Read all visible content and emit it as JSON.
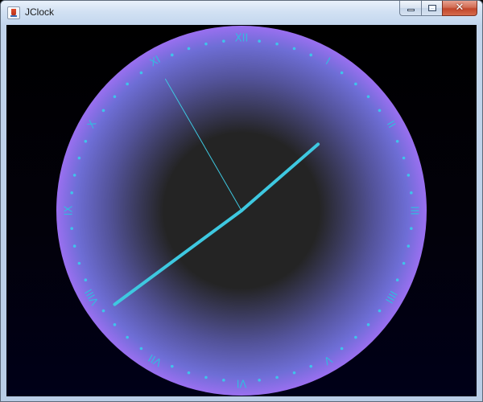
{
  "window": {
    "title": "JClock",
    "icon": "java-icon",
    "controls": [
      "minimize",
      "maximize",
      "close"
    ],
    "close_glyph": "✕"
  },
  "clock": {
    "type": "analog",
    "numerals": [
      "XII",
      "I",
      "II",
      "III",
      "IIII",
      "V",
      "VI",
      "VII",
      "VIII",
      "IX",
      "X",
      "XI"
    ],
    "time_shown": "1:38:55",
    "colors": {
      "face_center": "#242424",
      "face_mid": "#6e6ed6",
      "face_edge": "#9a6ff0",
      "numerals": "#35b8e0",
      "ticks": "#3fc3ea",
      "hands": "#3ec8e0",
      "background": "#000000"
    }
  }
}
